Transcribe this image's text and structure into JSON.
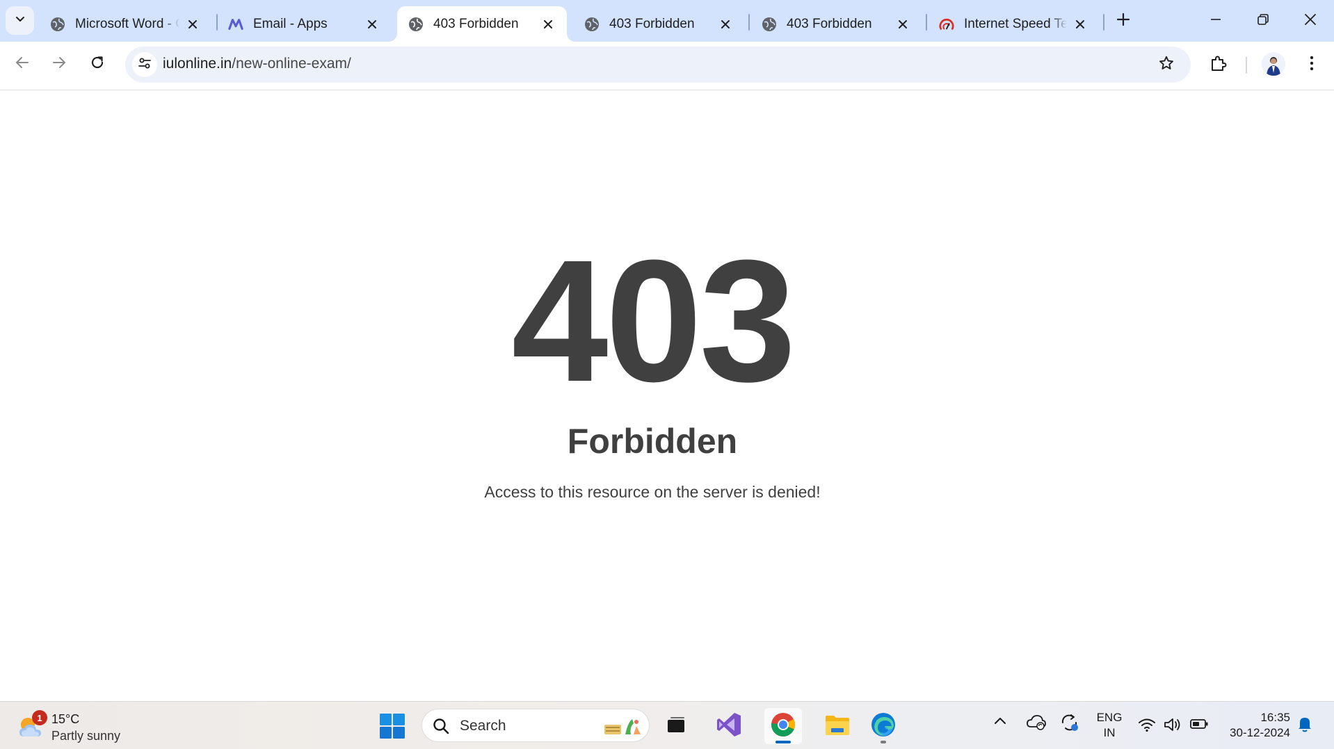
{
  "browser": {
    "tabs": [
      {
        "title": "Microsoft Word - C",
        "favicon": "globe-icon"
      },
      {
        "title": "Email - Apps",
        "favicon": "mail-apps-icon"
      },
      {
        "title": "403 Forbidden",
        "favicon": "globe-icon",
        "active": true
      },
      {
        "title": "403 Forbidden",
        "favicon": "globe-icon"
      },
      {
        "title": "403 Forbidden",
        "favicon": "globe-icon"
      },
      {
        "title": "Internet Speed Tes",
        "favicon": "speedometer-icon"
      }
    ],
    "url": {
      "host": "iulonline.in",
      "path": "/new-online-exam/"
    }
  },
  "page": {
    "code": "403",
    "title": "Forbidden",
    "message": "Access to this resource on the server is denied!"
  },
  "taskbar": {
    "weather": {
      "temperature": "15°C",
      "condition": "Partly sunny",
      "badge": "1"
    },
    "search_label": "Search",
    "apps": [
      "task-view-icon",
      "visual-studio-icon",
      "chrome-icon",
      "file-explorer-icon",
      "edge-icon"
    ],
    "language": {
      "line1": "ENG",
      "line2": "IN"
    },
    "clock": {
      "time": "16:35",
      "date": "30-12-2024"
    }
  },
  "colors": {
    "tabstrip": "#d3e3fd",
    "omnibox": "#edf2fa",
    "error_text": "#404040",
    "taskbar_accent": "#0067c0"
  }
}
